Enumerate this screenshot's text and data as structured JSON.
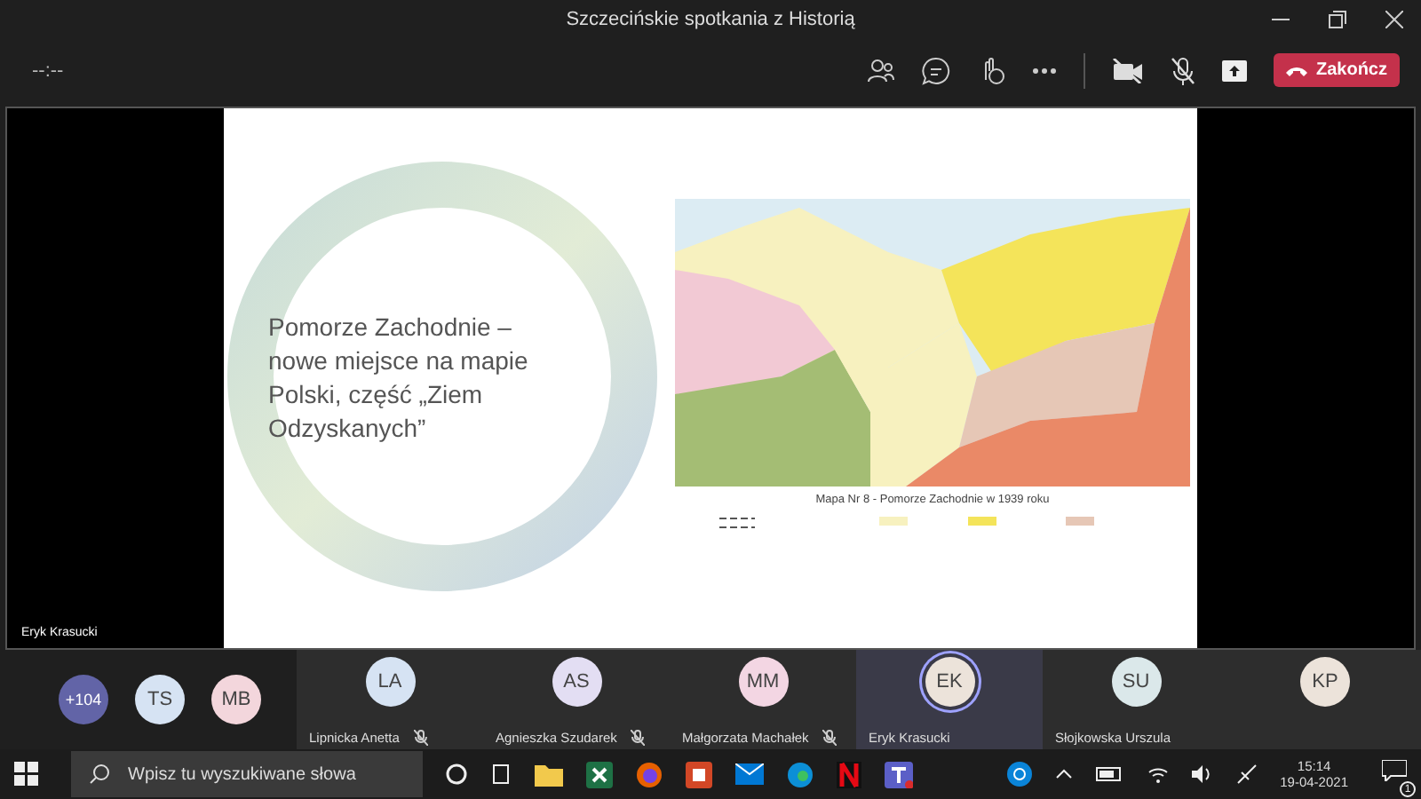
{
  "window": {
    "title": "Szczecińskie spotkania z Historią"
  },
  "toolbar": {
    "timer": "--:--",
    "end_button": "Zakończ",
    "camera_on": false,
    "mic_on": false
  },
  "stage": {
    "presenter": "Eryk Krasucki",
    "slide": {
      "heading": "Pomorze Zachodnie – nowe miejsce na mapie Polski, część „Ziem Odzyskanych”",
      "map_caption": "Mapa Nr 8 - Pomorze Zachodnie w 1939 roku"
    }
  },
  "overflow": {
    "count": "+104"
  },
  "gallery": [
    {
      "initials": "TS",
      "color": "#d6e3f3"
    },
    {
      "initials": "MB",
      "color": "#f3d6dc"
    }
  ],
  "participants": [
    {
      "initials": "LA",
      "name": "Lipnicka Anetta",
      "color": "#d6e3f3",
      "muted": true,
      "speaking": false
    },
    {
      "initials": "AS",
      "name": "Agnieszka Szudarek",
      "color": "#e3def3",
      "muted": true,
      "speaking": false
    },
    {
      "initials": "MM",
      "name": "Małgorzata Machałek",
      "color": "#f3d6e3",
      "muted": true,
      "speaking": false
    },
    {
      "initials": "EK",
      "name": "Eryk Krasucki",
      "color": "#ece3da",
      "muted": false,
      "speaking": true
    },
    {
      "initials": "SU",
      "name": "Słojkowska Urszula",
      "color": "#dbe8ea",
      "muted": false,
      "speaking": false
    },
    {
      "initials": "KP",
      "color": "#ece3da",
      "muted": false,
      "speaking": false
    }
  ],
  "taskbar": {
    "search_placeholder": "Wpisz tu wyszukiwane słowa",
    "time": "15:14",
    "date": "19-04-2021",
    "notifications": "1"
  }
}
